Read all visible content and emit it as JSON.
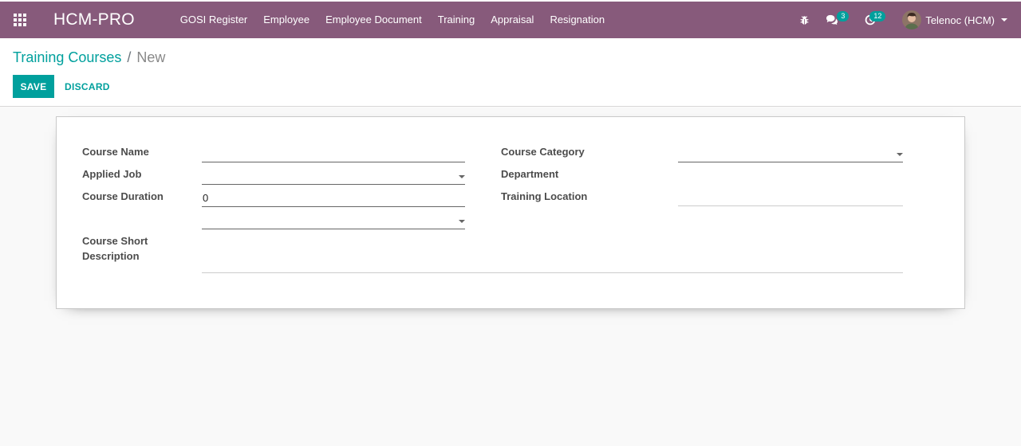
{
  "navbar": {
    "brand": "HCM-PRO",
    "menu": [
      "GOSI Register",
      "Employee",
      "Employee Document",
      "Training",
      "Appraisal",
      "Resignation"
    ],
    "messages_count": "3",
    "activities_count": "12",
    "user_name": "Telenoc (HCM)"
  },
  "breadcrumb": {
    "parent": "Training Courses",
    "separator": "/",
    "current": "New"
  },
  "actions": {
    "save_label": "SAVE",
    "discard_label": "DISCARD"
  },
  "form": {
    "course_name_label": "Course Name",
    "course_name_value": "",
    "applied_job_label": "Applied Job",
    "applied_job_value": "",
    "course_duration_label": "Course Duration",
    "course_duration_value": "0",
    "duration_unit_value": "",
    "course_short_description_label_line1": "Course Short",
    "course_short_description_label_line2": "Description",
    "course_short_description_value": "",
    "course_category_label": "Course Category",
    "course_category_value": "",
    "department_label": "Department",
    "department_value": "",
    "training_location_label": "Training Location",
    "training_location_value": ""
  },
  "colors": {
    "navbar": "#875a7b",
    "accent": "#00a09d"
  }
}
